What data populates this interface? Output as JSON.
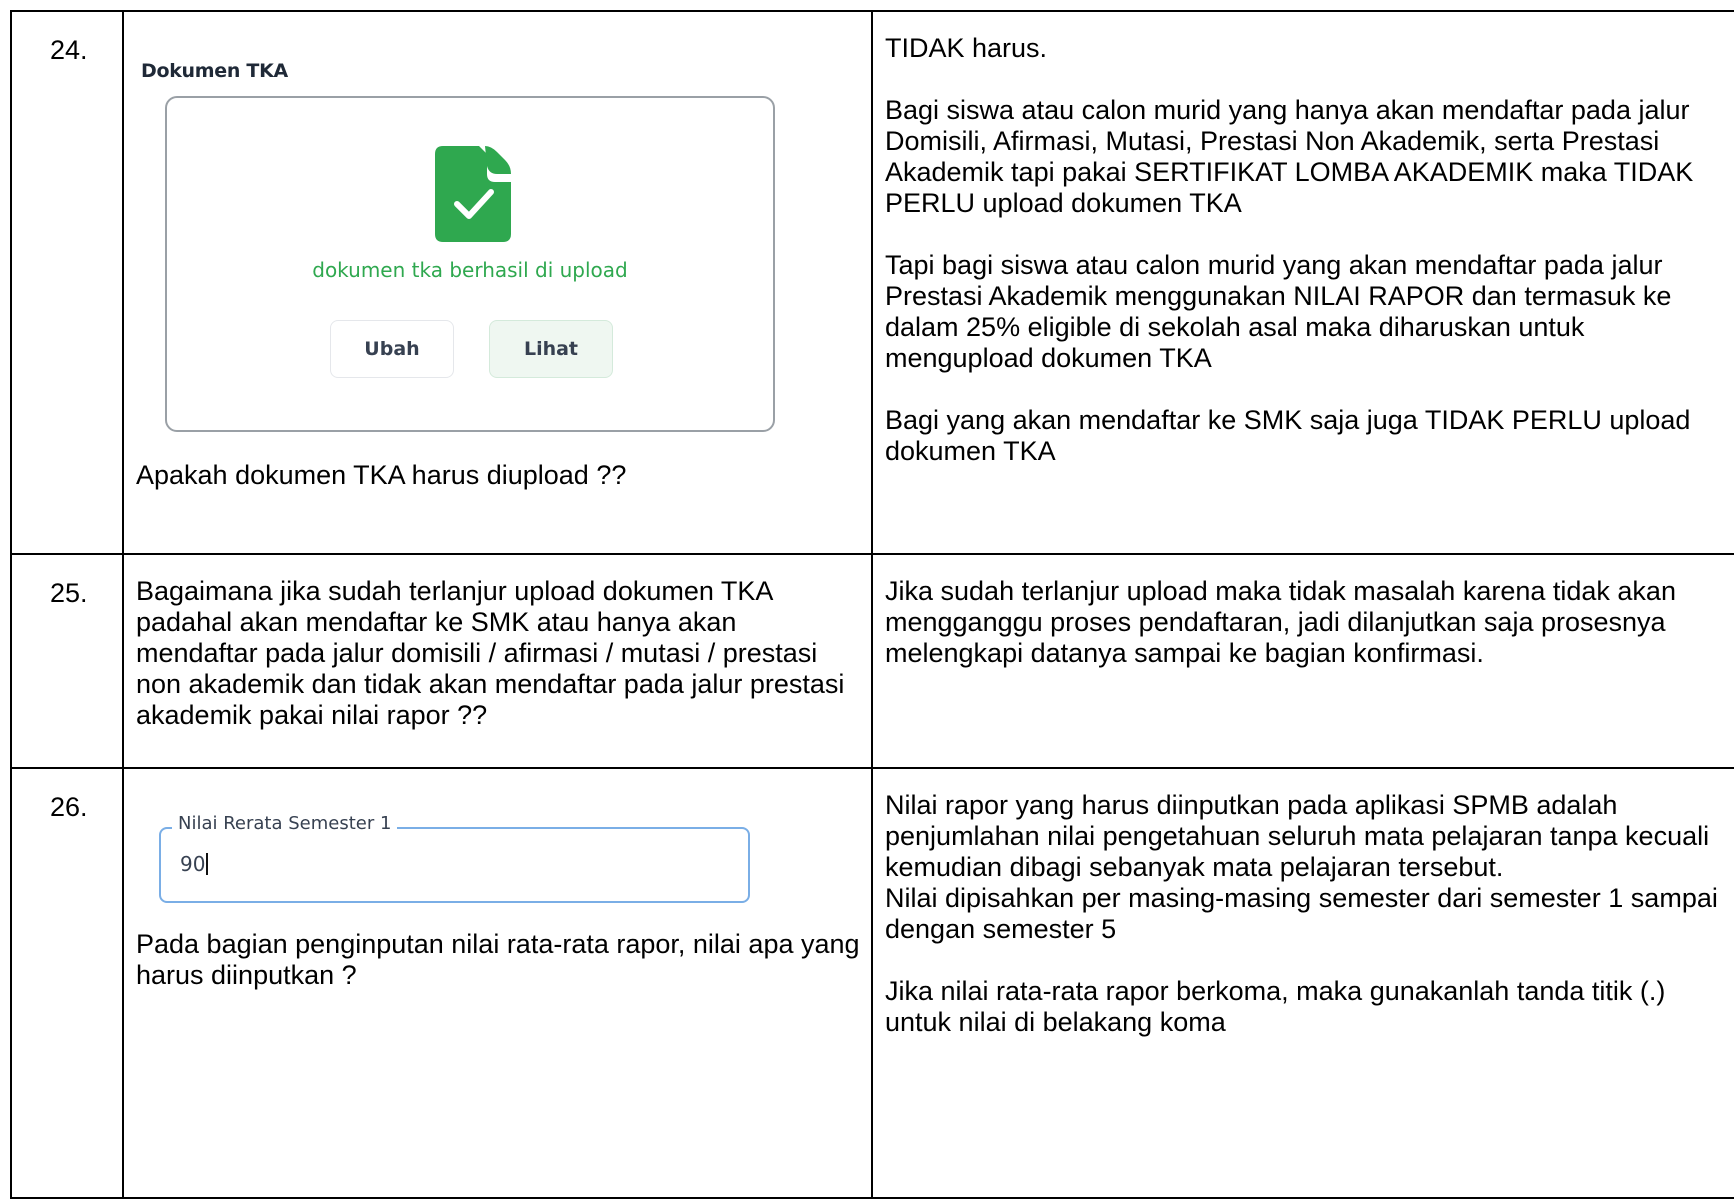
{
  "rows": [
    {
      "number": "24.",
      "mock": {
        "title": "Dokumen TKA",
        "status": "dokumen tka berhasil di upload",
        "buttons": {
          "change": "Ubah",
          "view": "Lihat"
        }
      },
      "question": "Apakah dokumen TKA harus diupload ??",
      "answer": [
        "TIDAK harus.",
        "Bagi siswa atau calon murid yang hanya akan mendaftar pada jalur Domisili, Afirmasi, Mutasi, Prestasi Non Akademik, serta Prestasi Akademik tapi pakai SERTIFIKAT LOMBA AKADEMIK maka TIDAK PERLU upload dokumen TKA",
        "Tapi bagi siswa atau calon murid yang akan mendaftar pada jalur Prestasi Akademik menggunakan NILAI RAPOR dan termasuk ke dalam 25% eligible di sekolah asal maka diharuskan untuk mengupload dokumen TKA",
        "Bagi yang akan mendaftar ke SMK saja juga TIDAK PERLU upload dokumen TKA"
      ]
    },
    {
      "number": "25.",
      "question": "Bagaimana jika sudah terlanjur upload dokumen TKA padahal akan mendaftar ke SMK atau hanya akan mendaftar pada jalur domisili / afirmasi / mutasi / prestasi non akademik dan tidak akan mendaftar pada jalur prestasi akademik pakai nilai rapor ??",
      "answer": [
        "Jika sudah terlanjur upload maka tidak masalah karena tidak akan mengganggu proses pendaftaran, jadi dilanjutkan saja prosesnya melengkapi datanya sampai ke bagian konfirmasi."
      ]
    },
    {
      "number": "26.",
      "mock": {
        "field_label": "Nilai Rerata Semester 1",
        "field_value": "90"
      },
      "question": "Pada bagian penginputan nilai rata-rata rapor, nilai apa yang harus diinputkan ?",
      "answer": [
        "Nilai rapor yang harus diinputkan pada aplikasi SPMB adalah penjumlahan nilai pengetahuan seluruh mata pelajaran tanpa kecuali kemudian dibagi sebanyak mata pelajaran tersebut.\nNilai dipisahkan per masing-masing semester dari semester 1 sampai dengan semester 5",
        "Jika nilai rata-rata rapor berkoma, maka gunakanlah tanda titik (.) untuk nilai di belakang koma"
      ]
    }
  ],
  "colors": {
    "success_green": "#2fa84f",
    "icon_green": "#2fa84f",
    "input_border_blue": "#7aaee6",
    "table_border": "#000000"
  },
  "icons": [
    "document-check-icon",
    "text-caret"
  ]
}
